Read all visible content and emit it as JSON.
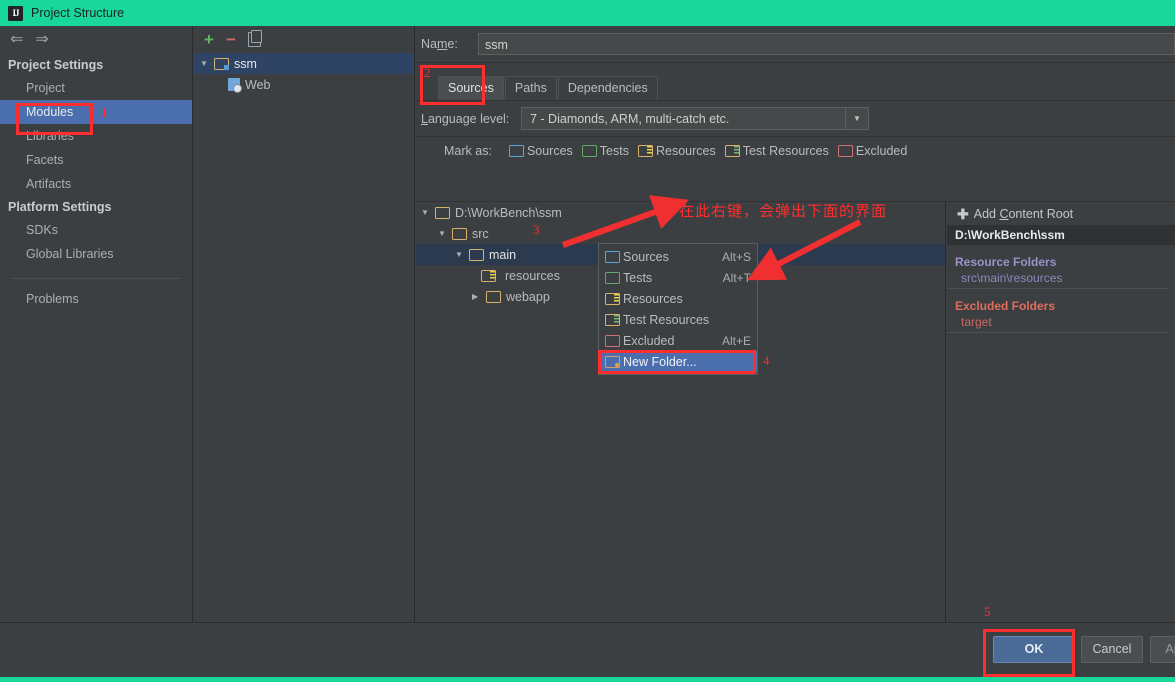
{
  "window": {
    "title": "Project Structure",
    "logo_text": "IJ"
  },
  "sidebar": {
    "back_icon": "⇐",
    "forward_icon": "⇒",
    "groups": [
      {
        "label": "Project Settings",
        "items": [
          "Project",
          "Modules",
          "Libraries",
          "Facets",
          "Artifacts"
        ]
      },
      {
        "label": "Platform Settings",
        "items": [
          "SDKs",
          "Global Libraries"
        ]
      }
    ],
    "selected_item": "Modules",
    "problems_label": "Problems"
  },
  "modules_panel": {
    "toolbar": {
      "add": "+",
      "remove": "−",
      "copy": "copy-icon"
    },
    "tree": [
      {
        "label": "ssm",
        "level": 0,
        "expanded": true,
        "selected": true
      },
      {
        "label": "Web",
        "level": 1,
        "expanded": false,
        "selected": false
      }
    ]
  },
  "detail": {
    "name_label": "Name:",
    "name_value": "ssm",
    "tabs": [
      {
        "label": "Sources",
        "active": true
      },
      {
        "label": "Paths",
        "active": false
      },
      {
        "label": "Dependencies",
        "active": false
      }
    ],
    "language_level_label": "Language level:",
    "language_level_value": "7 - Diamonds, ARM, multi-catch etc.",
    "mark_as_label": "Mark as:",
    "mark_as": [
      "Sources",
      "Tests",
      "Resources",
      "Test Resources",
      "Excluded"
    ]
  },
  "root_tree": [
    {
      "label": "D:\\WorkBench\\ssm",
      "level": 0,
      "expanded": true,
      "selected": false,
      "icon": "folder"
    },
    {
      "label": "src",
      "level": 1,
      "expanded": true,
      "selected": false,
      "icon": "folder"
    },
    {
      "label": "main",
      "level": 2,
      "expanded": true,
      "selected": true,
      "icon": "folder"
    },
    {
      "label": "resources",
      "level": 3,
      "expanded": false,
      "selected": false,
      "icon": "resources"
    },
    {
      "label": "webapp",
      "level": 3,
      "expanded": false,
      "collapsed_arrow": true,
      "selected": false,
      "icon": "folder"
    }
  ],
  "right_panel": {
    "add_content_root": "Add Content Root",
    "content_root_path": "D:\\WorkBench\\ssm",
    "resource_folders_title": "Resource Folders",
    "resource_folders_value": "src\\main\\resources",
    "excluded_folders_title": "Excluded Folders",
    "excluded_folders_value": "target"
  },
  "context_menu": {
    "items": [
      {
        "label": "Sources",
        "shortcut": "Alt+S",
        "icon": "sources-folder-icon",
        "highlighted": false
      },
      {
        "label": "Tests",
        "shortcut": "Alt+T",
        "icon": "tests-folder-icon",
        "highlighted": false
      },
      {
        "label": "Resources",
        "shortcut": "",
        "icon": "resources-folder-icon",
        "highlighted": false
      },
      {
        "label": "Test Resources",
        "shortcut": "",
        "icon": "test-resources-folder-icon",
        "highlighted": false
      },
      {
        "label": "Excluded",
        "shortcut": "Alt+E",
        "icon": "excluded-folder-icon",
        "highlighted": false
      },
      {
        "label": "New Folder...",
        "shortcut": "",
        "icon": "new-folder-icon",
        "highlighted": true
      }
    ]
  },
  "buttons": {
    "ok": "OK",
    "cancel": "Cancel",
    "apply": "Apply"
  },
  "annotations": {
    "n1": "1",
    "n2": "2",
    "n3": "3",
    "n4": "4",
    "n5": "5",
    "note_cn": "在此右键，会弹出下面的界面"
  },
  "colors": {
    "title_bar": "#19d79b",
    "panel_bg": "#3c3f41",
    "selection_blue": "#4b6eaf",
    "tree_selection": "#2b3a4f",
    "annotation_red": "#ff2d2d",
    "ok_button": "#4a6a98"
  }
}
